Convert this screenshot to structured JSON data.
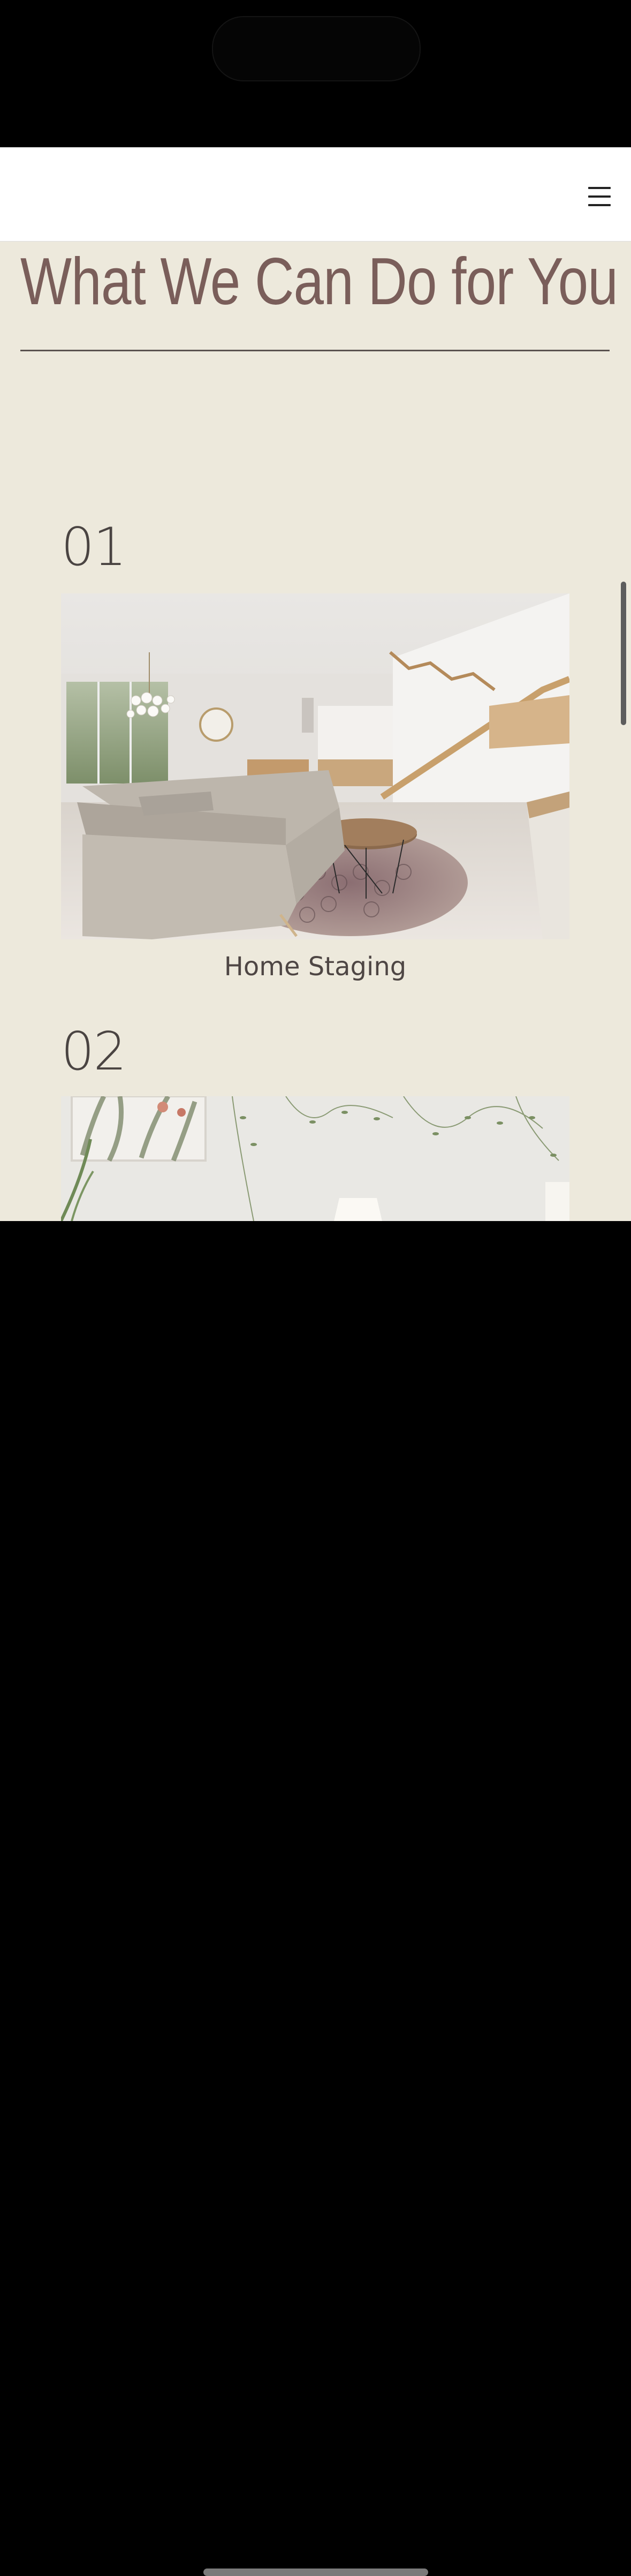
{
  "header": {
    "menu_icon": "hamburger-menu-icon"
  },
  "section": {
    "title": "What We Can Do for You",
    "items": [
      {
        "number": "01",
        "caption": "Home Staging",
        "image": "living-room-photo"
      },
      {
        "number": "02",
        "caption": "",
        "image": "wall-decor-photo"
      }
    ]
  },
  "colors": {
    "background": "#EDE9DC",
    "title": "#7A5E5A",
    "text": "#4a4442",
    "header": "#FFFFFF"
  }
}
